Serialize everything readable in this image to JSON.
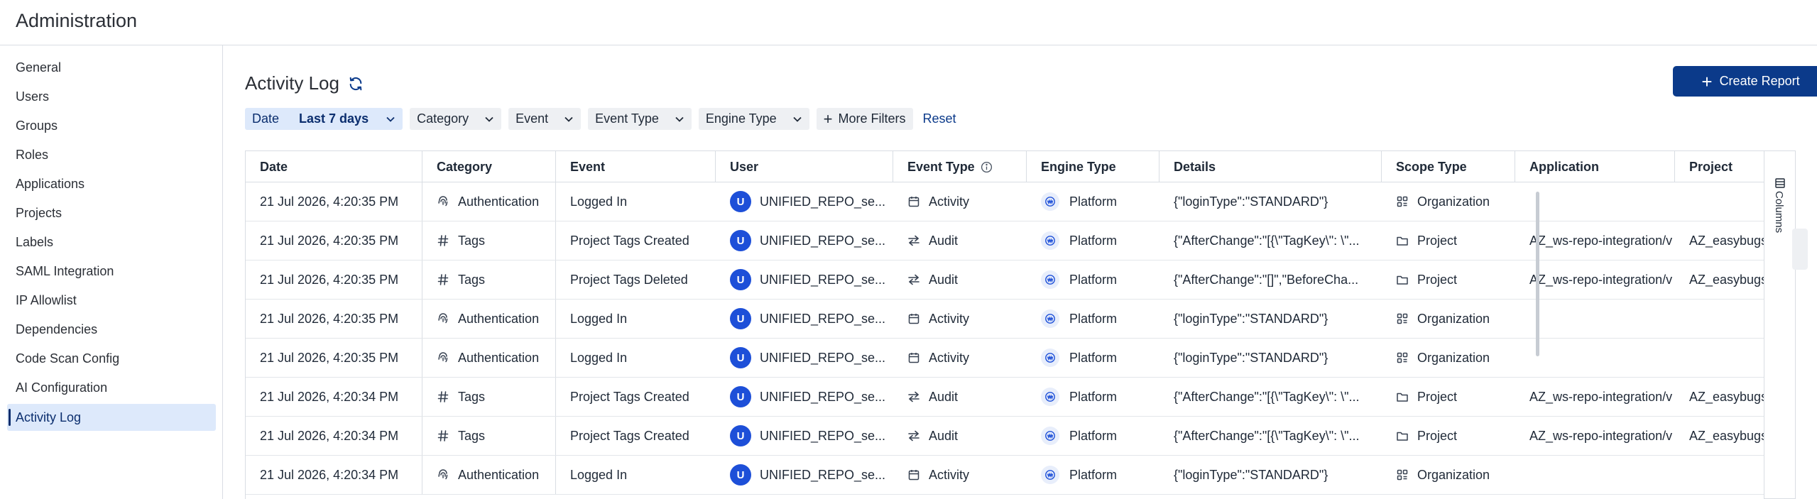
{
  "header": {
    "title": "Administration"
  },
  "sidebar": {
    "items": [
      {
        "label": "General"
      },
      {
        "label": "Users"
      },
      {
        "label": "Groups"
      },
      {
        "label": "Roles"
      },
      {
        "label": "Applications"
      },
      {
        "label": "Projects"
      },
      {
        "label": "Labels"
      },
      {
        "label": "SAML Integration"
      },
      {
        "label": "IP Allowlist"
      },
      {
        "label": "Dependencies"
      },
      {
        "label": "Code Scan Config"
      },
      {
        "label": "AI Configuration"
      },
      {
        "label": "Activity Log"
      }
    ],
    "active": "Activity Log"
  },
  "page": {
    "title": "Activity Log",
    "create_report_label": "Create Report"
  },
  "filters": {
    "date_key": "Date",
    "date_value": "Last 7 days",
    "category": "Category",
    "event": "Event",
    "event_type": "Event Type",
    "engine_type": "Engine Type",
    "more_filters": "More Filters",
    "reset": "Reset"
  },
  "table": {
    "columns": [
      "Date",
      "Category",
      "Event",
      "User",
      "Event Type",
      "Engine Type",
      "Details",
      "Scope Type",
      "Application",
      "Project"
    ],
    "rows": [
      {
        "date": "21 Jul 2026, 4:20:35 PM",
        "category": "Authentication",
        "event": "Logged In",
        "avatar": "U",
        "user": "UNIFIED_REPO_se...",
        "event_type": "Activity",
        "engine_type": "Platform",
        "details": "{\"loginType\":\"STANDARD\"}",
        "scope_type": "Organization",
        "application": "",
        "project": ""
      },
      {
        "date": "21 Jul 2026, 4:20:35 PM",
        "category": "Tags",
        "event": "Project Tags Created",
        "avatar": "U",
        "user": "UNIFIED_REPO_se...",
        "event_type": "Audit",
        "engine_type": "Platform",
        "details": "{\"AfterChange\":\"[{\\\"TagKey\\\": \\\"...",
        "scope_type": "Project",
        "application": "AZ_ws-repo-integration/v",
        "project": "AZ_easybugs"
      },
      {
        "date": "21 Jul 2026, 4:20:35 PM",
        "category": "Tags",
        "event": "Project Tags Deleted",
        "avatar": "U",
        "user": "UNIFIED_REPO_se...",
        "event_type": "Audit",
        "engine_type": "Platform",
        "details": "{\"AfterChange\":\"[]\",\"BeforeCha...",
        "scope_type": "Project",
        "application": "AZ_ws-repo-integration/v",
        "project": "AZ_easybugs"
      },
      {
        "date": "21 Jul 2026, 4:20:35 PM",
        "category": "Authentication",
        "event": "Logged In",
        "avatar": "U",
        "user": "UNIFIED_REPO_se...",
        "event_type": "Activity",
        "engine_type": "Platform",
        "details": "{\"loginType\":\"STANDARD\"}",
        "scope_type": "Organization",
        "application": "",
        "project": ""
      },
      {
        "date": "21 Jul 2026, 4:20:35 PM",
        "category": "Authentication",
        "event": "Logged In",
        "avatar": "U",
        "user": "UNIFIED_REPO_se...",
        "event_type": "Activity",
        "engine_type": "Platform",
        "details": "{\"loginType\":\"STANDARD\"}",
        "scope_type": "Organization",
        "application": "",
        "project": ""
      },
      {
        "date": "21 Jul 2026, 4:20:34 PM",
        "category": "Tags",
        "event": "Project Tags Created",
        "avatar": "U",
        "user": "UNIFIED_REPO_se...",
        "event_type": "Audit",
        "engine_type": "Platform",
        "details": "{\"AfterChange\":\"[{\\\"TagKey\\\": \\\"...",
        "scope_type": "Project",
        "application": "AZ_ws-repo-integration/v",
        "project": "AZ_easybugs"
      },
      {
        "date": "21 Jul 2026, 4:20:34 PM",
        "category": "Tags",
        "event": "Project Tags Created",
        "avatar": "U",
        "user": "UNIFIED_REPO_se...",
        "event_type": "Audit",
        "engine_type": "Platform",
        "details": "{\"AfterChange\":\"[{\\\"TagKey\\\": \\\"...",
        "scope_type": "Project",
        "application": "AZ_ws-repo-integration/v",
        "project": "AZ_easybugs"
      },
      {
        "date": "21 Jul 2026, 4:20:34 PM",
        "category": "Authentication",
        "event": "Logged In",
        "avatar": "U",
        "user": "UNIFIED_REPO_se...",
        "event_type": "Activity",
        "engine_type": "Platform",
        "details": "{\"loginType\":\"STANDARD\"}",
        "scope_type": "Organization",
        "application": "",
        "project": ""
      }
    ]
  },
  "column_panel": {
    "label": "Columns"
  },
  "colors": {
    "accent": "#0b3a8a",
    "active_bg": "#dde9fb",
    "avatar": "#1d4fd8"
  }
}
